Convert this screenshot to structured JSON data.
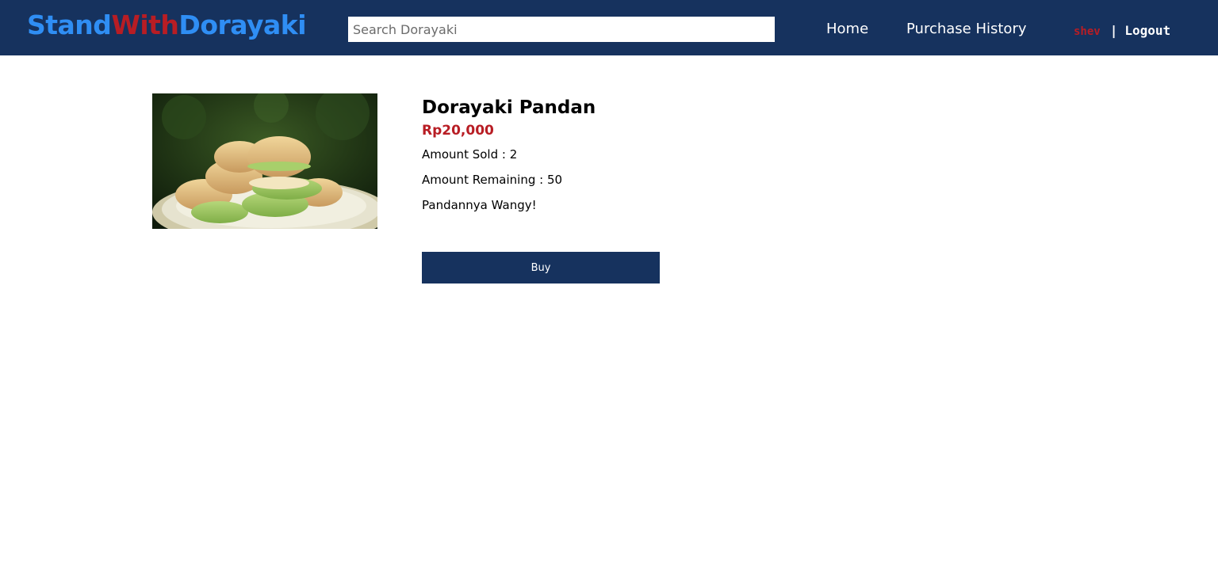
{
  "header": {
    "logo": {
      "part1": "Stand",
      "part2": "With",
      "part3": "Dorayaki"
    },
    "search": {
      "placeholder": "Search Dorayaki",
      "value": ""
    },
    "nav": {
      "home": "Home",
      "purchase_history": "Purchase History"
    },
    "user": {
      "username": "shev",
      "separator": "|",
      "logout": "Logout"
    }
  },
  "product": {
    "name": "Dorayaki Pandan",
    "price": "Rp20,000",
    "amount_sold": "Amount Sold : 2",
    "amount_remaining": "Amount Remaining : 50",
    "description": "Pandannya Wangy!",
    "buy_label": "Buy"
  },
  "colors": {
    "navbar": "#16325e",
    "logo_blue": "#2f8ef4",
    "accent_red": "#b81d24",
    "button": "#16325e"
  }
}
